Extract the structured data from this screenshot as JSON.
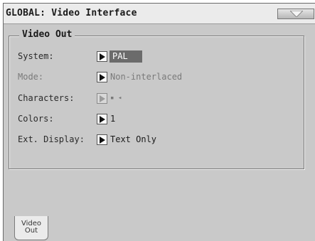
{
  "header": {
    "title": "GLOBAL: Video Interface",
    "menu_icon": "triangle-down-icon"
  },
  "section": {
    "title": "Video Out",
    "rows": [
      {
        "label": "System:",
        "value": "PAL",
        "enabled": true,
        "selected": true
      },
      {
        "label": "Mode:",
        "value": "Non-interlaced",
        "enabled": false,
        "selected": false
      },
      {
        "label": "Characters:",
        "value": "▪ ◂",
        "enabled": false,
        "selected": false
      },
      {
        "label": "Colors:",
        "value": "1",
        "enabled": true,
        "selected": false
      },
      {
        "label": "Ext. Display:",
        "value": "Text Only",
        "enabled": true,
        "selected": false
      }
    ]
  },
  "tabs": [
    {
      "line1": "Video",
      "line2": "Out",
      "active": true
    }
  ],
  "colors": {
    "background": "#c9c9c9",
    "titlebar": "#ebebeb",
    "selected_value_bg": "#6b6b6b"
  }
}
